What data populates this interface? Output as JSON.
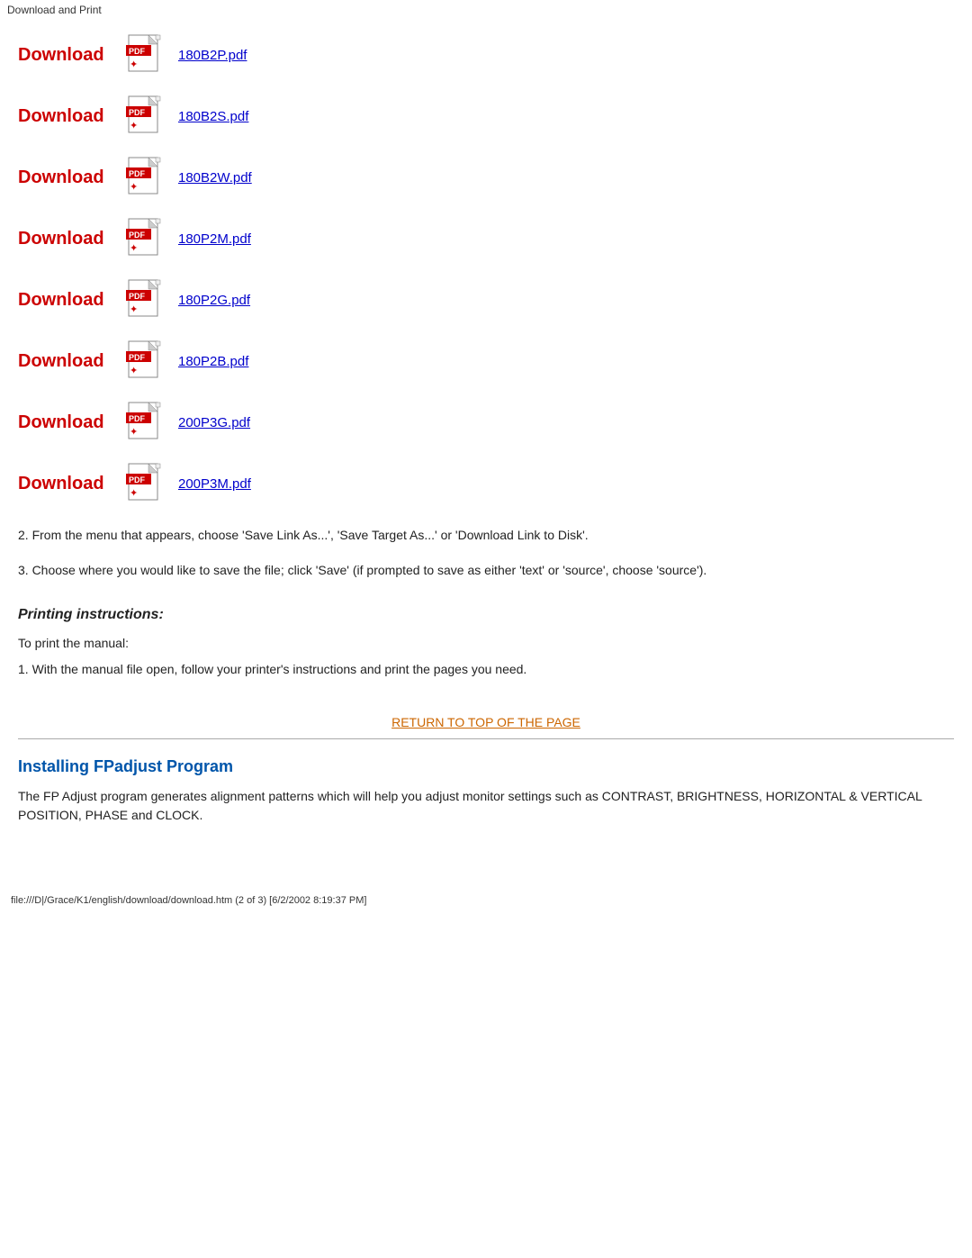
{
  "topbar": {
    "label": "Download and Print"
  },
  "downloads": [
    {
      "label": "Download",
      "filename": "180B2P.pdf"
    },
    {
      "label": "Download",
      "filename": "180B2S.pdf"
    },
    {
      "label": "Download",
      "filename": "180B2W.pdf"
    },
    {
      "label": "Download",
      "filename": "180P2M.pdf"
    },
    {
      "label": "Download",
      "filename": "180P2G.pdf"
    },
    {
      "label": "Download",
      "filename": "180P2B.pdf"
    },
    {
      "label": "Download",
      "filename": "200P3G.pdf"
    },
    {
      "label": "Download",
      "filename": "200P3M.pdf"
    }
  ],
  "instructions": {
    "step2": "2. From the menu that appears, choose 'Save Link As...', 'Save Target As...' or 'Download Link to Disk'.",
    "step3": "3. Choose where you would like to save the file; click 'Save' (if prompted to save as either 'text' or 'source', choose 'source')."
  },
  "printing": {
    "title": "Printing instructions:",
    "intro": "To print the manual:",
    "step1": "1. With the manual file open, follow your printer's instructions and print the pages you need."
  },
  "return_link": {
    "label": "RETURN TO TOP OF THE PAGE"
  },
  "fpadjust": {
    "title": "Installing FPadjust Program",
    "description": "The FP Adjust program generates alignment patterns which will help you adjust monitor settings such as CONTRAST, BRIGHTNESS, HORIZONTAL & VERTICAL POSITION, PHASE and CLOCK."
  },
  "footer": {
    "text": "file:///D|/Grace/K1/english/download/download.htm (2 of 3) [6/2/2002 8:19:37 PM]"
  }
}
